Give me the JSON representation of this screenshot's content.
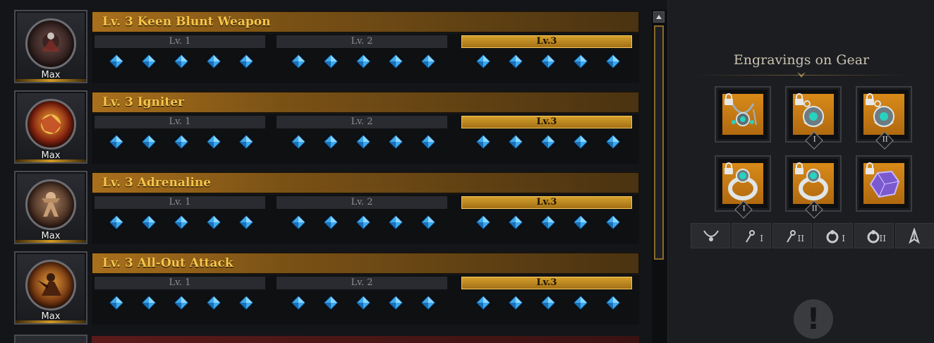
{
  "engravings": [
    {
      "title": "Lv. 3 Keen Blunt Weapon",
      "badge": "Max",
      "icon": "keen-blunt-weapon-icon",
      "levels": [
        "Lv. 1",
        "Lv. 2",
        "Lv.3"
      ],
      "active_level": 3
    },
    {
      "title": "Lv. 3 Igniter",
      "badge": "Max",
      "icon": "igniter-icon",
      "levels": [
        "Lv. 1",
        "Lv. 2",
        "Lv.3"
      ],
      "active_level": 3
    },
    {
      "title": "Lv. 3 Adrenaline",
      "badge": "Max",
      "icon": "adrenaline-icon",
      "levels": [
        "Lv. 1",
        "Lv. 2",
        "Lv.3"
      ],
      "active_level": 3
    },
    {
      "title": "Lv. 3 All-Out Attack",
      "badge": "Max",
      "icon": "all-out-attack-icon",
      "levels": [
        "Lv. 1",
        "Lv. 2",
        "Lv.3"
      ],
      "active_level": 3
    }
  ],
  "gear_panel": {
    "title": "Engravings on Gear",
    "slots": [
      {
        "item": "necklace-icon",
        "locked": true,
        "numeral": ""
      },
      {
        "item": "earring-icon",
        "locked": true,
        "numeral": "I"
      },
      {
        "item": "earring-icon",
        "locked": true,
        "numeral": "II"
      },
      {
        "item": "ring-icon",
        "locked": true,
        "numeral": "I"
      },
      {
        "item": "ring-icon",
        "locked": true,
        "numeral": "II"
      },
      {
        "item": "ability-stone-icon",
        "locked": true,
        "numeral": ""
      }
    ],
    "tabs": [
      {
        "icon": "necklace-icon",
        "numeral": ""
      },
      {
        "icon": "earring-icon",
        "numeral": "I"
      },
      {
        "icon": "earring-icon",
        "numeral": "II"
      },
      {
        "icon": "ring-icon",
        "numeral": "I"
      },
      {
        "icon": "ring-icon",
        "numeral": "II"
      },
      {
        "icon": "ability-stone-icon",
        "numeral": ""
      }
    ],
    "alert_symbol": "!"
  },
  "colors": {
    "gold_title": "#f8c64a",
    "gem_blue": "#3aa9f0",
    "slot_orange": "#d88a18"
  }
}
